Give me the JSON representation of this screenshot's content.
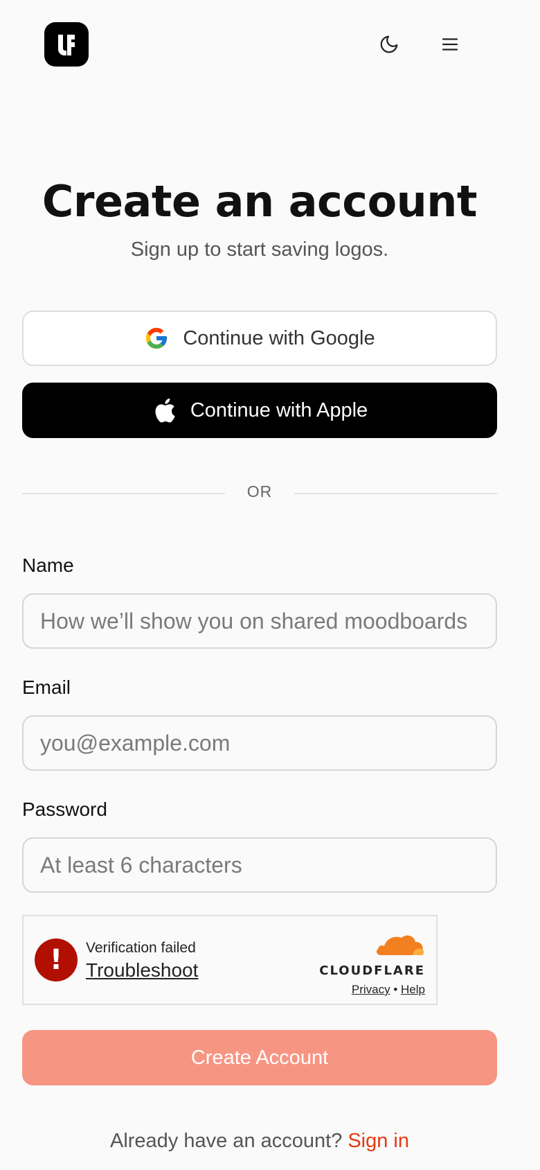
{
  "header": {
    "logo_icon": "logoflow-logo",
    "theme_icon": "moon-icon",
    "menu_icon": "hamburger-menu-icon"
  },
  "page": {
    "title": "Create an account",
    "subtitle": "Sign up to start saving logos."
  },
  "oauth": {
    "google_label": "Continue with Google",
    "apple_label": "Continue with Apple"
  },
  "divider": {
    "text": "OR"
  },
  "form": {
    "name_label": "Name",
    "name_placeholder": "How we’ll show you on shared moodboards",
    "name_value": "",
    "email_label": "Email",
    "email_placeholder": "you@example.com",
    "email_value": "",
    "password_label": "Password",
    "password_placeholder": "At least 6 characters",
    "password_value": ""
  },
  "captcha": {
    "status": "Verification failed",
    "troubleshoot": "Troubleshoot",
    "brand": "CLOUDFLARE",
    "privacy": "Privacy",
    "separator": "•",
    "help": "Help"
  },
  "submit": {
    "label": "Create Account"
  },
  "footer": {
    "prompt": "Already have an account?",
    "signin": "Sign in"
  },
  "colors": {
    "accent": "#e53a10",
    "submit_bg": "#f79583",
    "error": "#b20f03",
    "cloudflare_orange": "#f38020"
  }
}
